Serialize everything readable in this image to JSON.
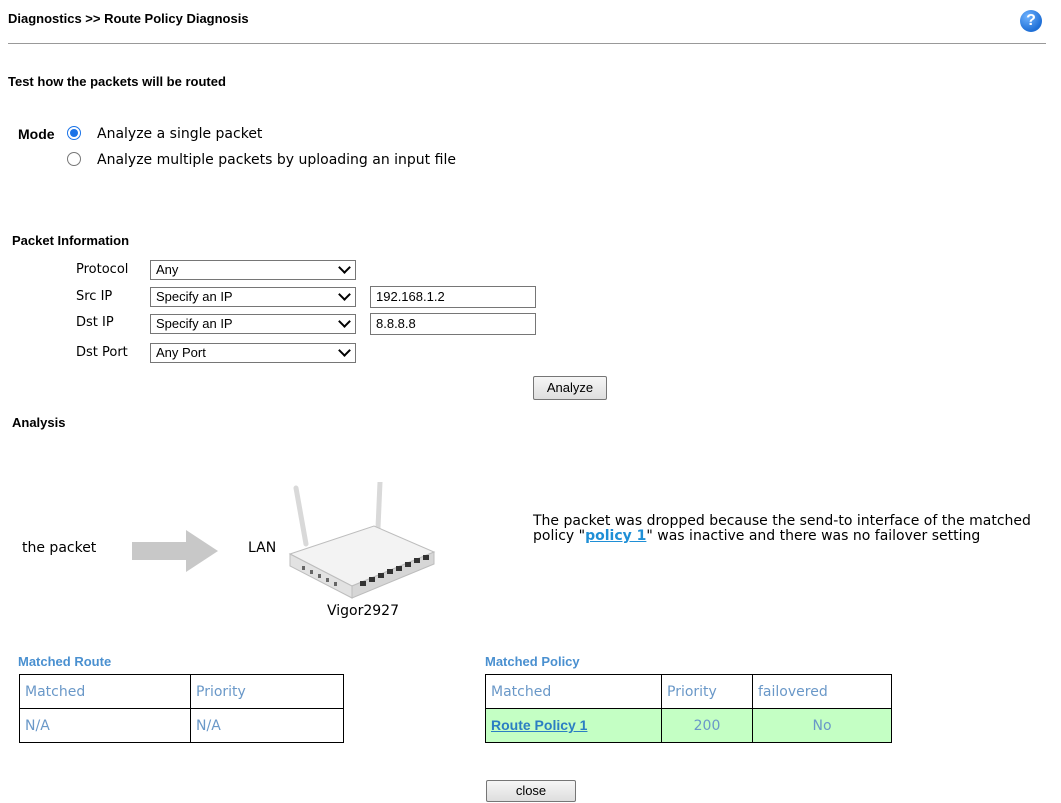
{
  "header": {
    "title": "Diagnostics >> Route Policy Diagnosis",
    "help_icon": "help-icon"
  },
  "subtitle": "Test how the packets will be routed",
  "mode": {
    "label": "Mode",
    "options": [
      {
        "label": "Analyze a single packet",
        "checked": true
      },
      {
        "label": "Analyze multiple packets by uploading an input file",
        "checked": false
      }
    ]
  },
  "packet_info": {
    "heading": "Packet Information",
    "protocol": {
      "label": "Protocol",
      "value": "Any"
    },
    "src_ip": {
      "label": "Src IP",
      "value": "Specify an IP",
      "ip": "192.168.1.2"
    },
    "dst_ip": {
      "label": "Dst IP",
      "value": "Specify an IP",
      "ip": "8.8.8.8"
    },
    "dst_port": {
      "label": "Dst Port",
      "value": "Any Port"
    },
    "analyze_label": "Analyze"
  },
  "analysis": {
    "heading": "Analysis",
    "packet_label": "the packet",
    "interface_label": "LAN",
    "router_name": "Vigor2927",
    "message_before": "The packet was dropped because the send-to interface of the matched policy \"",
    "message_link": "policy 1",
    "message_after": "\" was inactive and there was no failover setting"
  },
  "matched_route": {
    "heading": "Matched Route",
    "columns": [
      "Matched",
      "Priority"
    ],
    "row": [
      "N/A",
      "N/A"
    ]
  },
  "matched_policy": {
    "heading": "Matched Policy",
    "columns": [
      "Matched",
      "Priority",
      "failovered"
    ],
    "row": [
      "Route Policy 1",
      "200",
      "No"
    ],
    "highlight_color": "#c4ffc4"
  },
  "footer": {
    "close_label": "close"
  }
}
